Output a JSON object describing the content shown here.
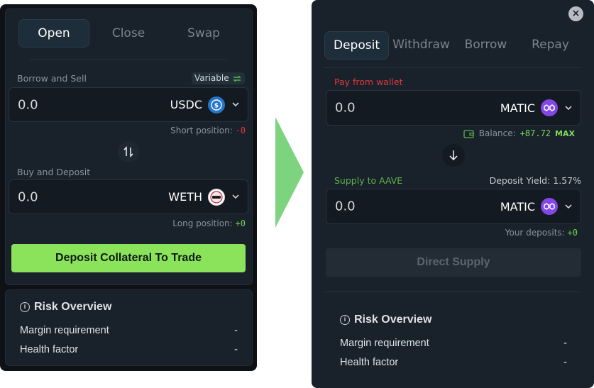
{
  "left": {
    "tabs": [
      {
        "label": "Open",
        "active": true
      },
      {
        "label": "Close",
        "active": false
      },
      {
        "label": "Swap",
        "active": false
      }
    ],
    "borrow": {
      "label": "Borrow and Sell",
      "badge": "Variable",
      "amount": "0.0",
      "token": "USDC",
      "note_label": "Short position:",
      "note_value": "-0"
    },
    "buy": {
      "label": "Buy and Deposit",
      "amount": "0.0",
      "token": "WETH",
      "note_label": "Long position:",
      "note_value": "+0"
    },
    "cta": "Deposit Collateral To Trade",
    "risk": {
      "title": "Risk Overview",
      "rows": [
        {
          "label": "Margin requirement",
          "value": "-"
        },
        {
          "label": "Health factor",
          "value": "-"
        }
      ]
    }
  },
  "right": {
    "close_label": "×",
    "tabs": [
      {
        "label": "Deposit",
        "active": true
      },
      {
        "label": "Withdraw",
        "active": false
      },
      {
        "label": "Borrow",
        "active": false
      },
      {
        "label": "Repay",
        "active": false
      }
    ],
    "pay": {
      "label": "Pay from wallet",
      "amount": "0.0",
      "token": "MATIC",
      "balance_label": "Balance:",
      "balance_value": "+87.72",
      "max": "MAX"
    },
    "supply": {
      "label": "Supply to AAVE",
      "yield": "Deposit Yield: 1.57%",
      "amount": "0.0",
      "token": "MATIC",
      "deposits_label": "Your deposits:",
      "deposits_value": "+0"
    },
    "action": "Direct Supply",
    "risk": {
      "title": "Risk Overview",
      "rows": [
        {
          "label": "Margin requirement",
          "value": "-"
        },
        {
          "label": "Health factor",
          "value": "-"
        }
      ]
    }
  },
  "colors": {
    "accent_green": "#8be35c",
    "negative": "#e2373f",
    "positive": "#6ed34e",
    "matic": "#8247e5",
    "usdc": "#2775ca",
    "arrow": "#7ed37f"
  },
  "icons": [
    "usdc-icon",
    "weth-icon",
    "matic-icon",
    "swap-arrows-icon",
    "arrow-down-icon",
    "wallet-icon",
    "info-icon",
    "close-icon",
    "chevron-down-icon",
    "refresh-icon"
  ]
}
